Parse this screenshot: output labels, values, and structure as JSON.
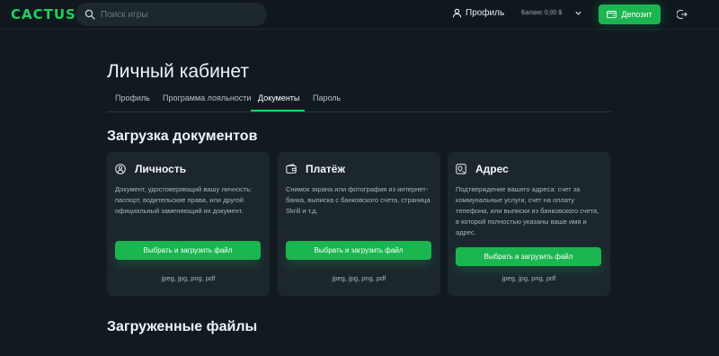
{
  "header": {
    "logo": "CACTUS",
    "search_placeholder": "Поиск игры",
    "profile_label": "Профиль",
    "balance_label": "Баланс 0,00 $",
    "deposit_label": "Депозит"
  },
  "colors": {
    "accent": "#1bb650",
    "background": "#111a20",
    "card": "#1c262d"
  },
  "page": {
    "title": "Личный кабинет",
    "tabs": [
      {
        "label": "Профиль",
        "active": false
      },
      {
        "label": "Программа лояльности",
        "active": false
      },
      {
        "label": "Документы",
        "active": true
      },
      {
        "label": "Пароль",
        "active": false
      }
    ]
  },
  "upload": {
    "title": "Загрузка документов",
    "cards": [
      {
        "icon": "person-icon",
        "title": "Личность",
        "description": "Документ, удостоверяющий вашу личность: паспорт, водительские права, или другой официальный заменяющий их документ.",
        "button": "Выбрать и загрузить файл",
        "formats": "jpeg, jpg, png, pdf"
      },
      {
        "icon": "wallet-icon",
        "title": "Платёж",
        "description": "Снимок экрана или фотография из интернет-банка, выписка с банковского счета, страница Skrill и т.д.",
        "button": "Выбрать и загрузить файл",
        "formats": "jpeg, jpg, png, pdf"
      },
      {
        "icon": "map-icon",
        "title": "Адрес",
        "description": "Подтверждение вашего адреса: счет за коммунальные услуги, счет на оплату телефона, или выписки из банковского счета, в которой полностью указаны ваше имя и адрес.",
        "button": "Выбрать и загрузить файл",
        "formats": "jpeg, jpg, png, pdf"
      }
    ]
  },
  "uploaded": {
    "title": "Загруженные файлы"
  }
}
